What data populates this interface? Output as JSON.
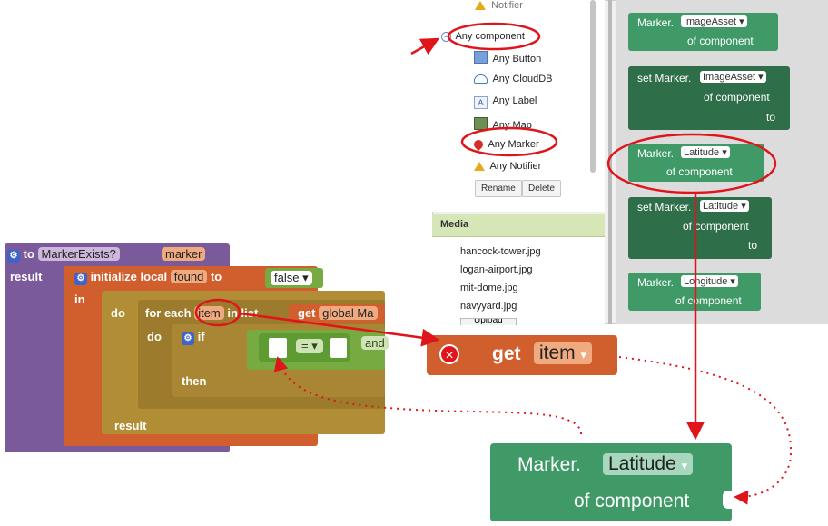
{
  "palette": {
    "tree": {
      "notifier_partial": "Notifier",
      "any_component": "Any component",
      "items": [
        "Any Button",
        "Any CloudDB",
        "Any Label",
        "Any Map",
        "Any Marker",
        "Any Notifier"
      ],
      "rename": "Rename",
      "delete": "Delete"
    },
    "media": {
      "header": "Media",
      "files": [
        "hancock-tower.jpg",
        "logan-airport.jpg",
        "mit-dome.jpg",
        "navyyard.jpg"
      ],
      "upload_partial": "Upload File"
    },
    "drawer": {
      "b1_prefix": "Marker.",
      "b1_prop": "ImageAsset",
      "b1_of": "of component",
      "b2_prefix": "set Marker.",
      "b2_prop": "ImageAsset",
      "b2_of": "of component",
      "b2_to": "to",
      "b3_prefix": "Marker.",
      "b3_prop": "Latitude",
      "b3_of": "of component",
      "b4_prefix": "set Marker.",
      "b4_prop": "Latitude",
      "b4_of": "of component",
      "b4_to": "to",
      "b5_prefix": "Marker.",
      "b5_prop": "Longitude",
      "b5_of": "of component"
    }
  },
  "workspace": {
    "proc_to": "to",
    "proc_name": "MarkerExists?",
    "proc_param": "marker",
    "result": "result",
    "init_local": "initialize local",
    "local_name": "found",
    "to": "to",
    "false_value": "false",
    "in": "in",
    "do": "do",
    "for_each": "for each",
    "item": "item",
    "in_list": "in list",
    "get": "get",
    "global_partial": "global Ma",
    "do2": "do",
    "if": "if",
    "eq": "=",
    "and_partial": "and",
    "then": "then",
    "result2": "result"
  },
  "callouts": {
    "get_item": {
      "get": "get",
      "var": "item"
    },
    "marker_latitude": {
      "prefix": "Marker.",
      "prop": "Latitude",
      "of": "of component"
    }
  },
  "colors": {
    "procedure": "#7b5a9b",
    "variable": "#d05f2d",
    "control": "#b18e35",
    "logic": "#77ab41",
    "component": "#3f9a67",
    "component_dark": "#2e6e48",
    "annotation": "#e0151b"
  }
}
